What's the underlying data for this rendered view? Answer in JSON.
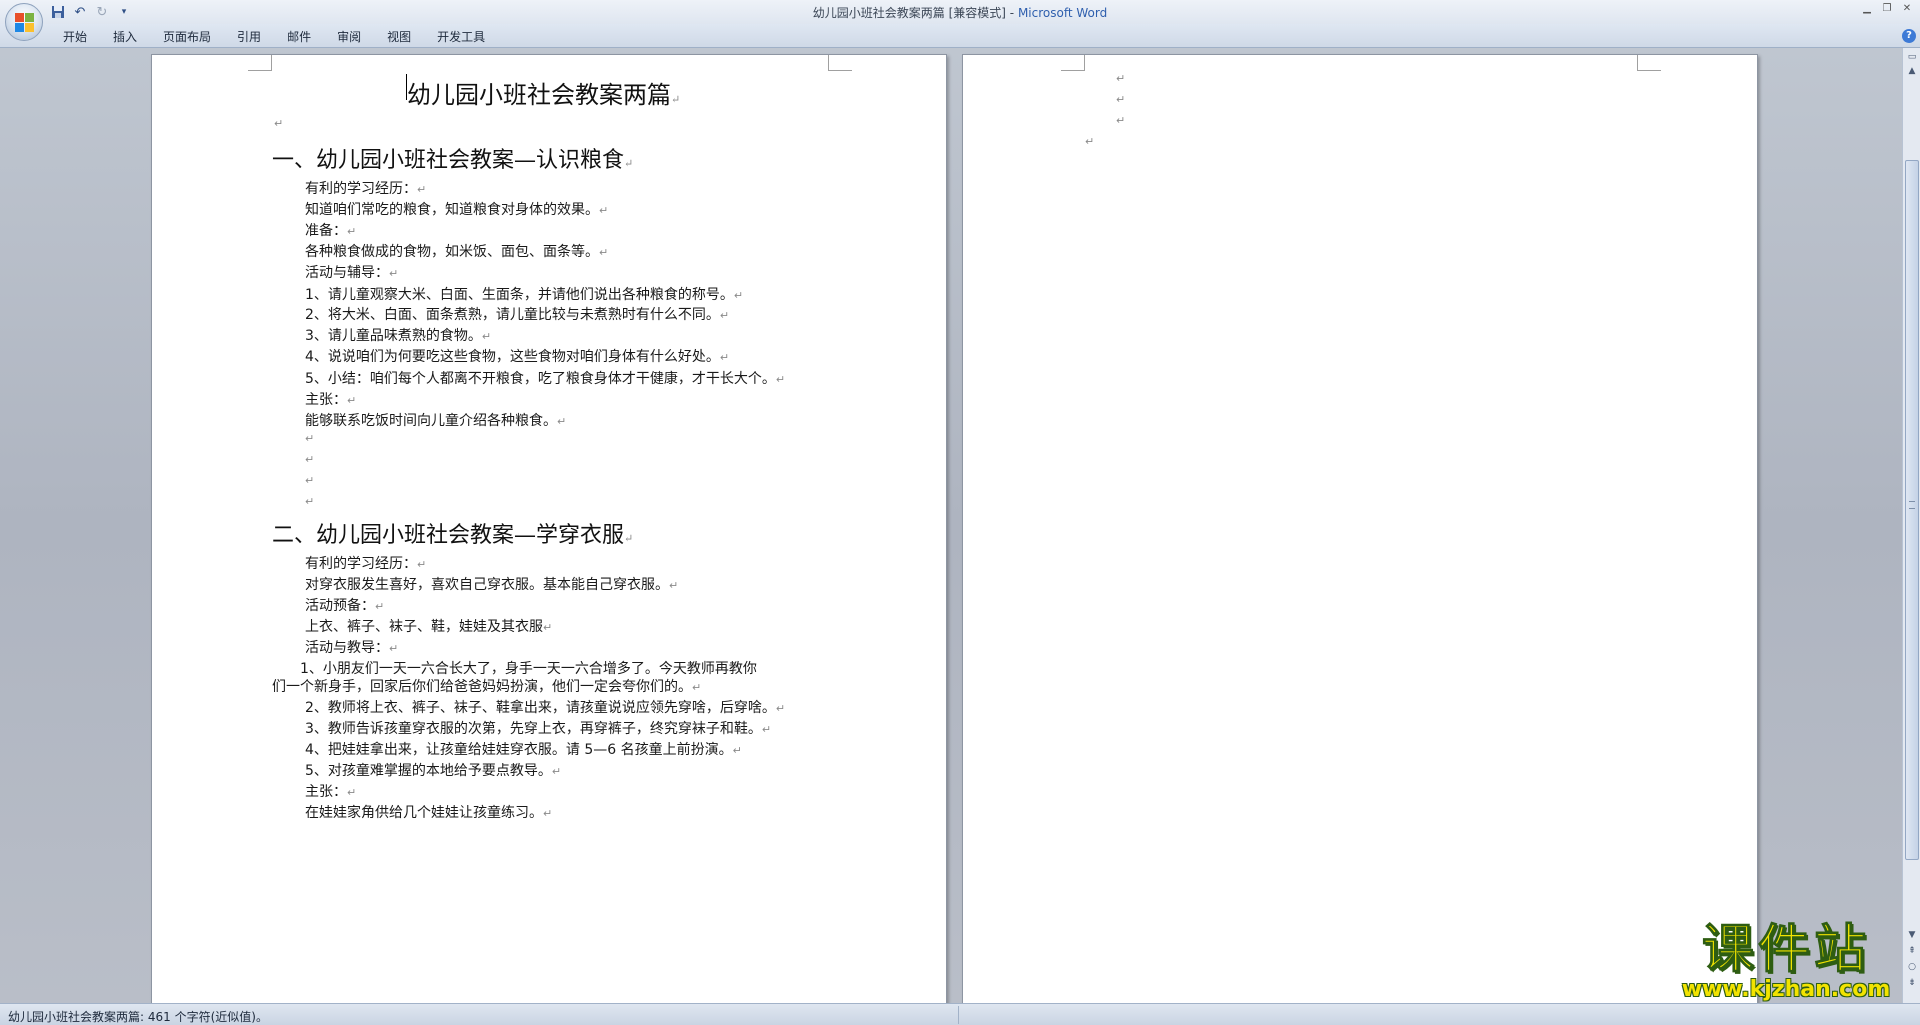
{
  "window": {
    "doc_name": "幼儿园小班社会教案两篇 [兼容模式] -",
    "app_name": "Microsoft Word",
    "minimize_icon": "minimize-icon",
    "restore_icon": "restore-icon",
    "close_icon": "close-icon"
  },
  "quick_access": {
    "save_icon": "save-icon",
    "undo_icon": "undo-icon",
    "redo_icon": "redo-icon",
    "customize_icon": "dropdown-icon"
  },
  "ribbon": {
    "tabs": [
      "开始",
      "插入",
      "页面布局",
      "引用",
      "邮件",
      "审阅",
      "视图",
      "开发工具"
    ],
    "help": "?"
  },
  "document": {
    "title": "幼儿园小班社会教案两篇",
    "section1": {
      "heading": "一、幼儿园小班社会教案—认识粮食",
      "lines": [
        "有利的学习经历：",
        "知道咱们常吃的粮食，知道粮食对身体的效果。",
        "准备：",
        "各种粮食做成的食物，如米饭、面包、面条等。",
        "活动与辅导：",
        "1、请儿童观察大米、白面、生面条，并请他们说出各种粮食的称号。",
        "2、将大米、白面、面条煮熟，请儿童比较与未煮熟时有什么不同。",
        "3、请儿童品味煮熟的食物。",
        "4、说说咱们为何要吃这些食物，这些食物对咱们身体有什么好处。",
        "5、小结：咱们每个人都离不开粮食，吃了粮食身体才干健康，才干长大个。",
        "主张：",
        "能够联系吃饭时间向儿童介绍各种粮食。"
      ]
    },
    "section2": {
      "heading": "二、幼儿园小班社会教案—学穿衣服",
      "lines": [
        "有利的学习经历：",
        "对穿衣服发生喜好，喜欢自己穿衣服。基本能自己穿衣服。",
        "活动预备：",
        "上衣、裤子、袜子、鞋，娃娃及其衣服",
        "活动与教导："
      ],
      "item1_line1": "1、小朋友们一天一六合长大了，身手一天一六合增多了。今天教师再教你",
      "item1_line2": "们一个新身手，回家后你们给爸爸妈妈扮演，他们一定会夸你们的。",
      "lines_after": [
        "2、教师将上衣、裤子、袜子、鞋拿出来，请孩童说说应领先穿啥，后穿啥。",
        "3、教师告诉孩童穿衣服的次第，先穿上衣，再穿裤子，终究穿袜子和鞋。",
        "4、把娃娃拿出来，让孩童给娃娃穿衣服。请 5—6 名孩童上前扮演。",
        "5、对孩童难掌握的本地给予要点教导。",
        "主张：",
        "在娃娃家角供给几个娃娃让孩童练习。"
      ]
    },
    "para_mark": "↵"
  },
  "statusbar": {
    "text": "幼儿园小班社会教案两篇: 461 个字符(近似值)。"
  },
  "watermark": {
    "cn": "课件站",
    "url": "www.kjzhan.com"
  },
  "colors": {
    "workspace": "#b4b9c2",
    "accent": "#2f5fae",
    "watermark": "#f2e300"
  }
}
